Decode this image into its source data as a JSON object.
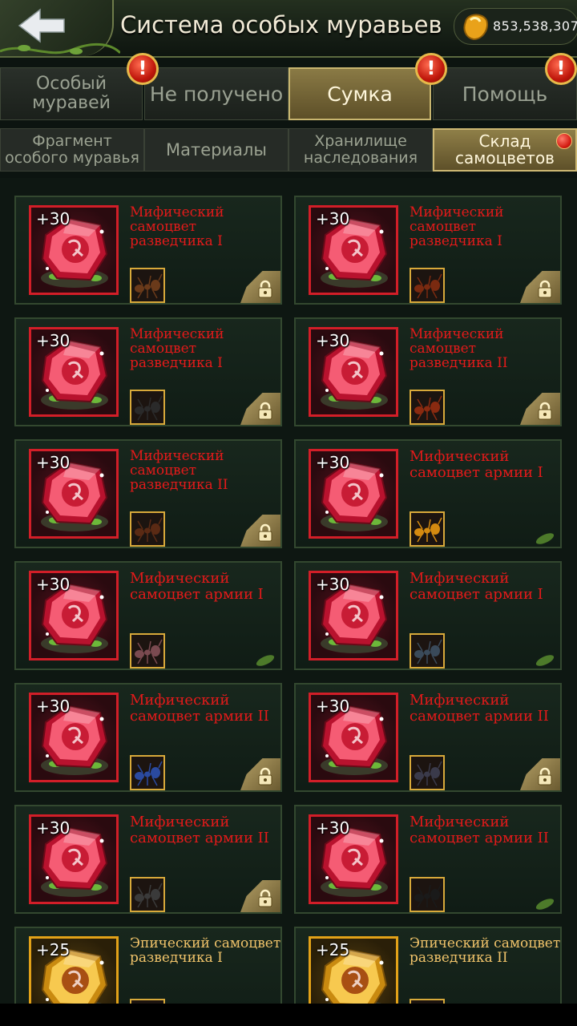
{
  "header": {
    "title": "Система особых муравьев",
    "currency_value": "853,538,307",
    "back_icon": "back-arrow-icon",
    "currency_icon": "amber-icon"
  },
  "tabs": [
    {
      "label": "Особый муравей",
      "alert": true,
      "active": false
    },
    {
      "label": "Не получено",
      "alert": false,
      "active": false
    },
    {
      "label": "Сумка",
      "alert": true,
      "active": true
    },
    {
      "label": "Помощь",
      "alert": true,
      "active": false
    }
  ],
  "alert_glyph": "!",
  "subtabs": [
    {
      "label": "Фрагмент особого муравья",
      "active": false
    },
    {
      "label": "Материалы",
      "active": false
    },
    {
      "label": "Хранилище наследования",
      "active": false
    },
    {
      "label": "Склад самоцветов",
      "active": true,
      "dot": true
    }
  ],
  "gems": [
    {
      "level": "+30",
      "name": "Мифический самоцвет разведчика I",
      "rarity": "mythic",
      "locked": true,
      "ant_color": "#6a3a1a"
    },
    {
      "level": "+30",
      "name": "Мифический самоцвет разведчика I",
      "rarity": "mythic",
      "locked": true,
      "ant_color": "#7a2a10"
    },
    {
      "level": "+30",
      "name": "Мифический самоцвет разведчика I",
      "rarity": "mythic",
      "locked": true,
      "ant_color": "#2a2a2a"
    },
    {
      "level": "+30",
      "name": "Мифический самоцвет разведчика II",
      "rarity": "mythic",
      "locked": true,
      "ant_color": "#8a2a10"
    },
    {
      "level": "+30",
      "name": "Мифический самоцвет разведчика II",
      "rarity": "mythic",
      "locked": true,
      "ant_color": "#5a2a14"
    },
    {
      "level": "+30",
      "name": "Мифический самоцвет армии I",
      "rarity": "mythic",
      "locked": false,
      "ant_color": "#d48a10"
    },
    {
      "level": "+30",
      "name": "Мифический самоцвет армии I",
      "rarity": "mythic",
      "locked": false,
      "ant_color": "#7a4a50"
    },
    {
      "level": "+30",
      "name": "Мифический самоцвет армии I",
      "rarity": "mythic",
      "locked": false,
      "ant_color": "#3a4a5a"
    },
    {
      "level": "+30",
      "name": "Мифический самоцвет армии II",
      "rarity": "mythic",
      "locked": true,
      "ant_color": "#2a4aa0"
    },
    {
      "level": "+30",
      "name": "Мифический самоцвет армии II",
      "rarity": "mythic",
      "locked": true,
      "ant_color": "#3a3a4a"
    },
    {
      "level": "+30",
      "name": "Мифический самоцвет армии II",
      "rarity": "mythic",
      "locked": true,
      "ant_color": "#3a3a3a"
    },
    {
      "level": "+30",
      "name": "Мифический самоцвет армии II",
      "rarity": "mythic",
      "locked": false,
      "ant_color": "#1a1a1a"
    },
    {
      "level": "+25",
      "name": "Эпический самоцвет разведчика I",
      "rarity": "epic",
      "locked": false,
      "ant_color": "#8a2a10"
    },
    {
      "level": "+25",
      "name": "Эпический самоцвет разведчика II",
      "rarity": "epic",
      "locked": false,
      "ant_color": "#3a3a3a"
    }
  ],
  "colors": {
    "mythic_text": "#e31a1a",
    "epic_text": "#f0c36a",
    "mythic_frame": "#d21e28",
    "epic_frame": "#e2a118",
    "active_tab": "#8a7a45"
  }
}
